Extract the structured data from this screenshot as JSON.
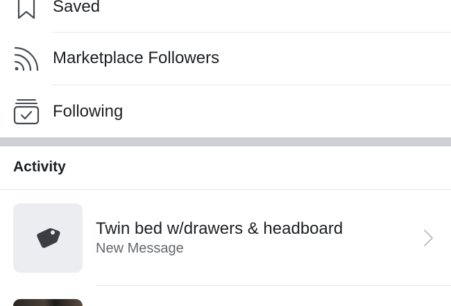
{
  "menu": {
    "items": [
      {
        "id": "saved",
        "label": "Saved",
        "icon": "bookmark-icon"
      },
      {
        "id": "marketplace-followers",
        "label": "Marketplace Followers",
        "icon": "rss-feed-icon"
      },
      {
        "id": "following",
        "label": "Following",
        "icon": "following-box-icon"
      }
    ]
  },
  "activity": {
    "header": "Activity",
    "items": [
      {
        "title": "Twin bed w/drawers & headboard",
        "subtitle": "New Message",
        "icon": "price-tag-icon"
      }
    ]
  },
  "colors": {
    "text_primary": "#1c1e21",
    "text_secondary": "#65676b",
    "divider": "#e4e6eb",
    "section_separator": "#ccd0d5",
    "thumb_bg": "#ebedf0",
    "icon": "#444950"
  }
}
